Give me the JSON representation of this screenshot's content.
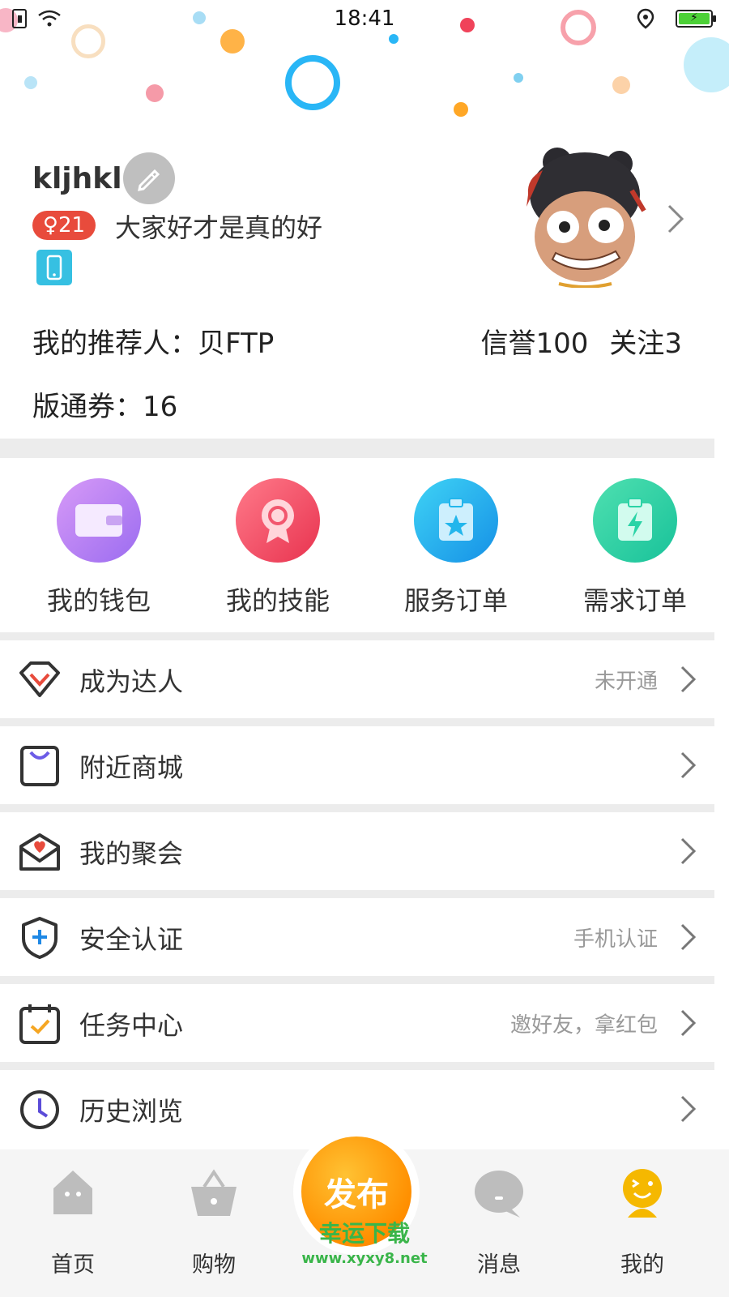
{
  "status_bar": {
    "time": "18:41"
  },
  "profile": {
    "username": "kljhkl",
    "gender_age": "♀21",
    "signature": "大家好才是真的好",
    "referrer": "我的推荐人：贝FTP",
    "credit": "信誉100",
    "follow": "关注3",
    "coupon": "版通券：16"
  },
  "quick_actions": [
    {
      "label": "我的钱包",
      "icon": "wallet-icon",
      "color": "#b67ef0"
    },
    {
      "label": "我的技能",
      "icon": "skill-badge-icon",
      "color": "#f2566e"
    },
    {
      "label": "服务订单",
      "icon": "service-order-icon",
      "color": "#22b6ec"
    },
    {
      "label": "需求订单",
      "icon": "demand-order-icon",
      "color": "#2ad3a6"
    }
  ],
  "menu": [
    {
      "label": "成为达人",
      "extra": "未开通",
      "icon": "diamond-icon"
    },
    {
      "label": "附近商城",
      "extra": "",
      "icon": "shopping-bag-icon"
    },
    {
      "label": "我的聚会",
      "extra": "",
      "icon": "envelope-heart-icon"
    },
    {
      "label": "安全认证",
      "extra": "手机认证",
      "icon": "shield-icon"
    },
    {
      "label": "任务中心",
      "extra": "邀好友，拿红包",
      "icon": "calendar-check-icon"
    },
    {
      "label": "历史浏览",
      "extra": "",
      "icon": "clock-icon"
    }
  ],
  "bottom_nav": {
    "home": "首页",
    "shop": "购物",
    "publish": "发布",
    "messages": "消息",
    "mine": "我的"
  },
  "watermark": {
    "title": "幸运下载",
    "url": "www.xyxy8.net"
  },
  "colors": {
    "accent": "#ff9800",
    "badge": "#e84b3c",
    "tab_active": "#f5b800"
  }
}
